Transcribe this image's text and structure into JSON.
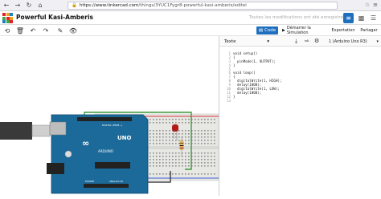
{
  "browser": {
    "url_host": "https://www.tinkercad.com",
    "url_path": "/things/3YUC1Fygr8-powerful-kasi-amberis/editel"
  },
  "header": {
    "project_title": "Powerful Kasi-Amberis",
    "project_sub": "",
    "save_status": "Toutes les modifications ont été enregistrées"
  },
  "toolbar": {
    "code_label": "Code",
    "simulate_label": "Démarrer la Simulation",
    "export_label": "Exportation",
    "share_label": "Partager"
  },
  "code_panel": {
    "mode": "Texte",
    "board": "1 (Arduino Uno R3)",
    "line_numbers": [
      "1",
      "2",
      "3",
      "4",
      "5",
      "6",
      "7",
      "8",
      "9",
      "10",
      "11",
      "12",
      "13"
    ],
    "lines": [
      "void setup()",
      "{",
      "  pinMode(1, OUTPUT);",
      "}",
      "",
      "void loop()",
      "{",
      "  digitalWrite(1, HIGH);",
      "  delay(1000);",
      "  digitalWrite(1, LOW);",
      "  delay(1000);",
      "}",
      ""
    ]
  },
  "board": {
    "label_uno": "UNO",
    "label_arduino": "ARDUINO",
    "label_digital": "DIGITAL (PWM~)",
    "label_power": "POWER",
    "label_analog": "ANALOG IN"
  },
  "colors": {
    "accent": "#1f6fbf",
    "board_blue": "#1c6a9a",
    "breadboard": "#e7e7e4",
    "led_red": "#b11a1a",
    "wire_green": "#3c9a3c"
  }
}
